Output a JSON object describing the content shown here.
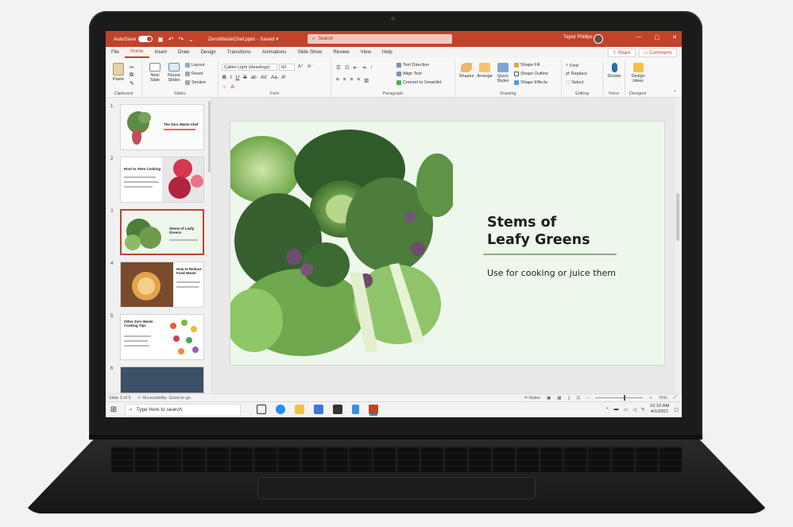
{
  "titlebar": {
    "autosave": "AutoSave",
    "toggle": "On",
    "filename": "ZeroWasteChef.pptx",
    "saved": "Saved",
    "search_placeholder": "Search",
    "user": "Taylor Phillips",
    "accent": "#c14329"
  },
  "menu": {
    "items": [
      "File",
      "Home",
      "Insert",
      "Draw",
      "Design",
      "Transitions",
      "Animations",
      "Slide Show",
      "Review",
      "View",
      "Help"
    ],
    "active": "Home",
    "share": "Share",
    "comments": "Comments"
  },
  "ribbon": {
    "clipboard": {
      "paste": "Paste",
      "label": "Clipboard"
    },
    "slides": {
      "new_slide": "New Slide",
      "reuse": "Reuse Slides",
      "layout": "Layout",
      "reset": "Reset",
      "section": "Section",
      "label": "Slides"
    },
    "font": {
      "family": "Calibri Light (Headings)",
      "size": "60",
      "bold": "B",
      "italic": "I",
      "underline": "U",
      "strike": "S",
      "label": "Font"
    },
    "paragraph": {
      "text_direction": "Text Direction",
      "align_text": "Align Text",
      "smartart": "Convert to SmartArt",
      "label": "Paragraph"
    },
    "drawing": {
      "shapes": "Shapes",
      "arrange": "Arrange",
      "quick_styles": "Quick Styles",
      "fill": "Shape Fill",
      "outline": "Shape Outline",
      "effects": "Shape Effects",
      "label": "Drawing"
    },
    "editing": {
      "find": "Find",
      "replace": "Replace",
      "select": "Select",
      "label": "Editing"
    },
    "voice": {
      "dictate": "Dictate",
      "label": "Voice"
    },
    "designer": {
      "ideas": "Design Ideas",
      "label": "Designer"
    }
  },
  "thumbnails": [
    {
      "num": "1",
      "title": "The Zero Waste Chef"
    },
    {
      "num": "2",
      "title": "Root to Stem Cooking"
    },
    {
      "num": "3",
      "title": "Stems of Leafy Greens"
    },
    {
      "num": "4",
      "title": "How to Reduce Food Waste"
    },
    {
      "num": "5",
      "title": "Other Zero Waste Cooking Tips"
    },
    {
      "num": "6",
      "title": ""
    }
  ],
  "slide": {
    "title_line1": "Stems of",
    "title_line2": "Leafy Greens",
    "subtitle": "Use for cooking or juice them"
  },
  "status": {
    "slide_info": "Slide 3 of 5",
    "accessibility": "Accessibility: Good to go",
    "notes": "Notes",
    "zoom": "76%"
  },
  "taskbar": {
    "search": "Type here to search",
    "time": "10:10 AM",
    "date": "4/1/2021"
  }
}
